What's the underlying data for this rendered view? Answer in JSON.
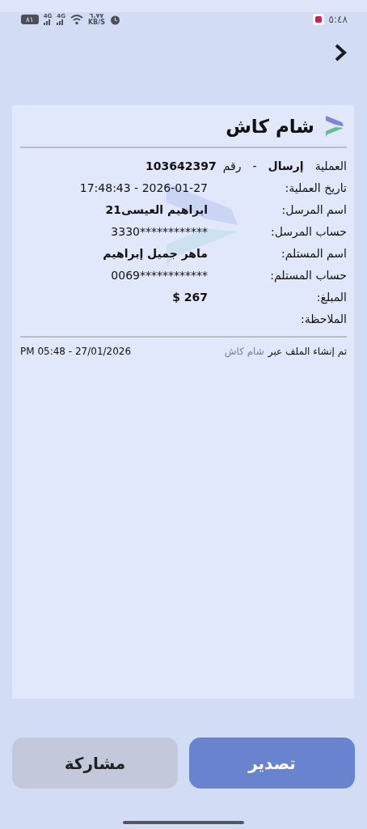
{
  "status_bar": {
    "time": "٥:٤٨",
    "battery": "٨١",
    "network_1": "4G",
    "network_2": "4G",
    "speed_value": "٦.٧٧",
    "speed_unit": "KB/S"
  },
  "receipt": {
    "brand": "شام كاش",
    "operation": {
      "label": "العملية",
      "type": "إرسال",
      "separator": "-",
      "number_label": "رقم",
      "number": "103642397"
    },
    "rows": [
      {
        "label": "تاريخ العملية:",
        "value": "17:48:43 - 2026-01-27",
        "bold": false
      },
      {
        "label": "اسم المرسل:",
        "value": "ابراهيم العيسى21",
        "bold": true
      },
      {
        "label": "حساب المرسل:",
        "value": "3330************",
        "bold": false
      },
      {
        "label": "اسم المستلم:",
        "value": "ماهر جميل إبراهيم",
        "bold": true
      },
      {
        "label": "حساب المستلم:",
        "value": "0069************",
        "bold": false
      },
      {
        "label": "المبلغ:",
        "value": "$ 267",
        "bold": true
      },
      {
        "label": "الملاحظة:"
      }
    ],
    "footer": {
      "created_via": "تم إنشاء الملف عبر",
      "app_link": "شام كاش",
      "timestamp": "PM 05:48 - 27/01/2026"
    }
  },
  "buttons": [
    {
      "label": "تصدير",
      "kind": "primary"
    },
    {
      "label": "مشاركة",
      "kind": "secondary"
    }
  ]
}
